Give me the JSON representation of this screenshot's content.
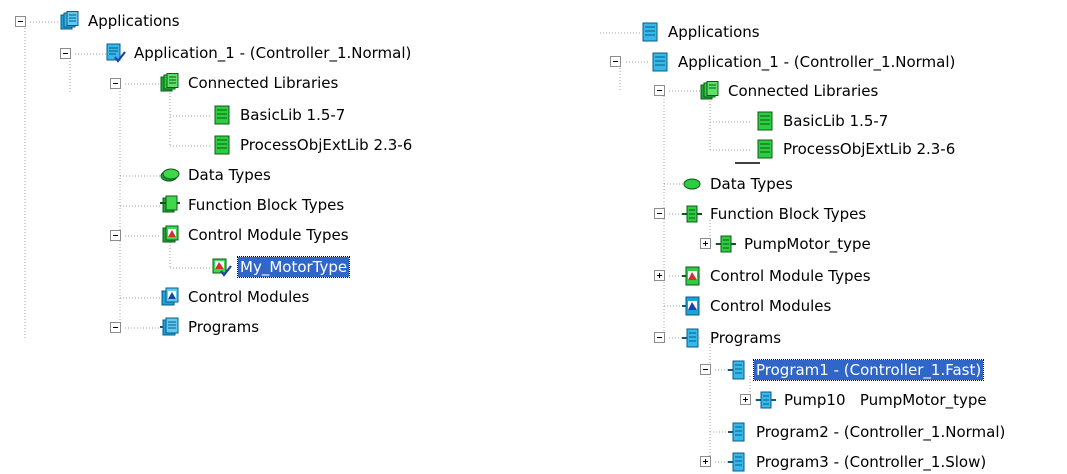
{
  "left_tree": {
    "root": "Applications",
    "application": "Application_1 - (Controller_1.Normal)",
    "connected_libraries": "Connected Libraries",
    "lib_basic": "BasicLib 1.5-7",
    "lib_process": "ProcessObjExtLib 2.3-6",
    "data_types": "Data Types",
    "function_block_types": "Function Block Types",
    "control_module_types": "Control Module Types",
    "my_motor_type": "My_MotorType",
    "control_modules": "Control Modules",
    "programs": "Programs"
  },
  "right_tree": {
    "root": "Applications",
    "application": "Application_1 - (Controller_1.Normal)",
    "connected_libraries": "Connected Libraries",
    "lib_basic": "BasicLib 1.5-7",
    "lib_process": "ProcessObjExtLib 2.3-6",
    "data_types": "Data Types",
    "function_block_types": "Function Block Types",
    "pump_motor_type": "PumpMotor_type",
    "control_module_types": "Control Module Types",
    "control_modules": "Control Modules",
    "programs": "Programs",
    "program1": "Program1 - (Controller_1.Fast)",
    "pump10": "Pump10   PumpMotor_type",
    "program2": "Program2 - (Controller_1.Normal)",
    "program3": "Program3 - (Controller_1.Slow)"
  },
  "icons": {
    "applications": "applications-folder-icon",
    "application": "application-icon",
    "connected_libraries": "libraries-folder-icon",
    "library": "library-icon",
    "data_types": "data-types-icon",
    "function_block_types": "function-block-types-icon",
    "control_module_types": "control-module-types-icon",
    "control_modules": "control-modules-icon",
    "programs": "programs-icon"
  },
  "colors": {
    "selection": "#3166c9",
    "tree_line": "#a0a0a0",
    "library_green": "#2ecc40",
    "program_blue": "#1aa3d8"
  }
}
